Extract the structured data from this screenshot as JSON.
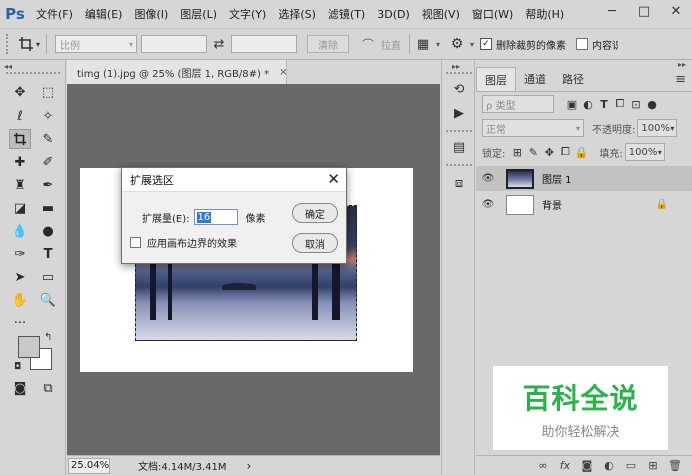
{
  "app": {
    "logo": "Ps"
  },
  "menu": {
    "items": [
      "文件(F)",
      "编辑(E)",
      "图像(I)",
      "图层(L)",
      "文字(Y)",
      "选择(S)",
      "滤镜(T)",
      "3D(D)",
      "视图(V)",
      "窗口(W)",
      "帮助(H)"
    ]
  },
  "window_controls": {
    "minimize": "─",
    "maximize": "□",
    "close": "✕"
  },
  "options_bar": {
    "ratio_label": "比例",
    "swap_icon": "⇄",
    "clear_label": "清除",
    "straighten_label": "拉直",
    "delete_cropped_label": "删除裁剪的像素",
    "delete_cropped_checked": true,
    "content_aware_label": "内容识别"
  },
  "document": {
    "tab_title": "timg (1).jpg @ 25% (图层 1, RGB/8#) *",
    "close": "×"
  },
  "status": {
    "zoom": "25.04%",
    "doc_size": "文档:4.14M/3.41M",
    "arrow": "›"
  },
  "dialog": {
    "title": "扩展选区",
    "close": "✕",
    "expand_label": "扩展量(E):",
    "expand_value": "16",
    "unit": "像素",
    "canvas_bounds_label": "应用画布边界的效果",
    "canvas_bounds_checked": false,
    "ok_label": "确定",
    "cancel_label": "取消"
  },
  "layers_panel": {
    "tabs": [
      "图层",
      "通道",
      "路径"
    ],
    "active_tab": 0,
    "filter_label": "ρ 类型",
    "blend_mode": "正常",
    "opacity_label": "不透明度:",
    "opacity_value": "100%",
    "lock_label": "锁定:",
    "fill_label": "填充:",
    "fill_value": "100%",
    "layers": [
      {
        "name": "图层 1",
        "selected": true
      },
      {
        "name": "背景",
        "selected": false
      }
    ],
    "bottom_icons": [
      "link-icon",
      "fx-icon",
      "mask-icon",
      "adjustment-icon",
      "group-icon",
      "new-layer-icon",
      "trash-icon"
    ]
  },
  "watermark": {
    "title": "百科全说",
    "subtitle": "助你轻松解决"
  },
  "colors": {
    "workspace": "#696969",
    "panel": "#d6d6d6",
    "accent": "#3278d6",
    "watermark_green": "#29b34a"
  }
}
